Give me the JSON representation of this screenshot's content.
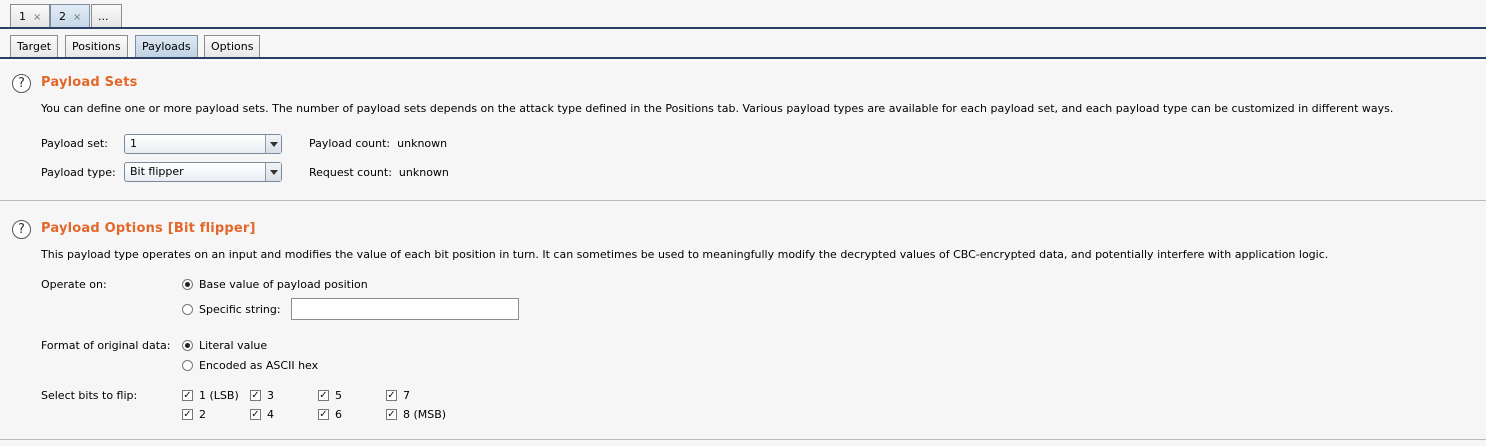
{
  "attack_tabs": [
    {
      "label": "1",
      "close": "×"
    },
    {
      "label": "2",
      "close": "×"
    },
    {
      "label": "..."
    }
  ],
  "sub_tabs": [
    "Target",
    "Positions",
    "Payloads",
    "Options"
  ],
  "payload_sets": {
    "title": "Payload Sets",
    "description": "You can define one or more payload sets. The number of payload sets depends on the attack type defined in the Positions tab. Various payload types are available for each payload set, and each payload type can be customized in different ways.",
    "set_label": "Payload set:",
    "set_value": "1",
    "type_label": "Payload type:",
    "type_value": "Bit flipper",
    "payload_count_label": "Payload count:",
    "payload_count_value": "unknown",
    "request_count_label": "Request count:",
    "request_count_value": "unknown"
  },
  "payload_options": {
    "title": "Payload Options [Bit flipper]",
    "description": "This payload type operates on an input and modifies the value of each bit position in turn. It can sometimes be used to meaningfully modify the decrypted values of CBC-encrypted data, and potentially interfere with application logic.",
    "operate_on_label": "Operate on:",
    "operate_on_options": [
      "Base value of payload position",
      "Specific string:"
    ],
    "specific_string_value": "",
    "format_label": "Format of original data:",
    "format_options": [
      "Literal value",
      "Encoded as ASCII hex"
    ],
    "bits_label": "Select bits to flip:",
    "bits": [
      "1 (LSB)",
      "2",
      "3",
      "4",
      "5",
      "6",
      "7",
      "8 (MSB)"
    ]
  },
  "help_glyph": "?",
  "check_glyph": "✓"
}
